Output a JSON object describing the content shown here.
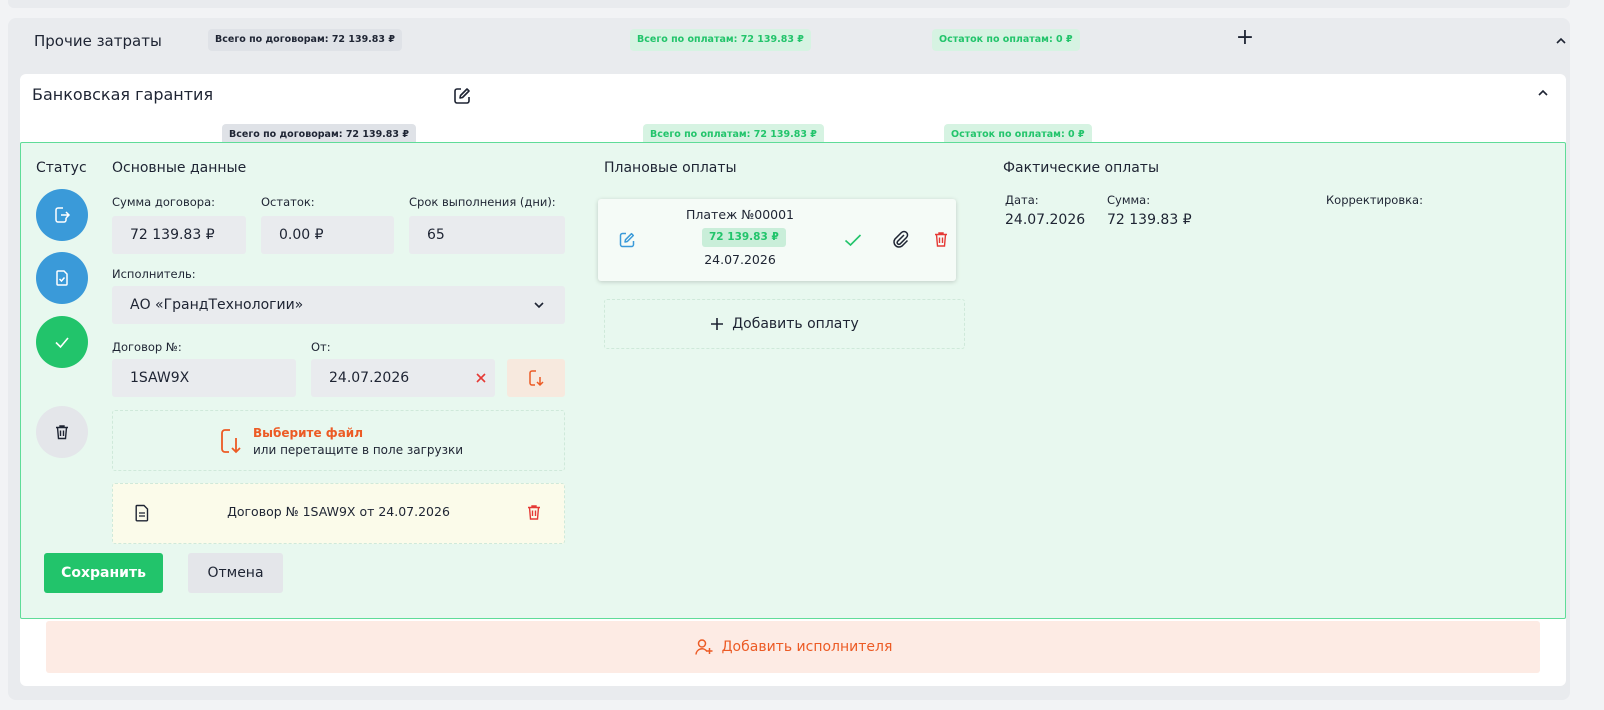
{
  "outer": {
    "title": "Прочие затраты",
    "tag_contracts": "Всего по договорам: 72 139.83 ₽",
    "tag_payments": "Всего по оплатам: 72 139.83 ₽",
    "tag_remaining": "Остаток по оплатам: 0 ₽"
  },
  "inner": {
    "title": "Банковская гарантия",
    "tag_contracts": "Всего по договорам: 72 139.83 ₽",
    "tag_payments": "Всего по оплатам: 72 139.83 ₽",
    "tag_remaining": "Остаток по оплатам: 0 ₽"
  },
  "status": {
    "heading": "Статус"
  },
  "main": {
    "heading": "Основные данные",
    "sum_label": "Сумма договора:",
    "sum_value": "72 139.83 ₽",
    "remain_label": "Остаток:",
    "remain_value": "0.00 ₽",
    "term_label": "Срок выполнения (дни):",
    "term_value": "65",
    "executor_label": "Исполнитель:",
    "executor_value": "АО «ГрандТехнологии»",
    "contract_label": "Договор №:",
    "contract_value": "1SAW9X",
    "from_label": "От:",
    "from_value": "24.07.2026",
    "upload_choose": "Выберите файл",
    "upload_drag": "или перетащите в поле загрузки",
    "file_name": "Договор № 1SAW9X от 24.07.2026"
  },
  "planned": {
    "heading": "Плановые оплаты",
    "payment_title": "Платеж №00001",
    "payment_amount": "72 139.83 ₽",
    "payment_date": "24.07.2026",
    "add_label": "Добавить оплату"
  },
  "actual": {
    "heading": "Фактические оплаты",
    "date_label": "Дата:",
    "date_value": "24.07.2026",
    "sum_label": "Сумма:",
    "sum_value": "72 139.83 ₽",
    "correction_label": "Корректировка:"
  },
  "actions": {
    "save": "Сохранить",
    "cancel": "Отмена",
    "add_executor": "Добавить исполнителя"
  },
  "colors": {
    "green": "#22c46b",
    "blue": "#3a9ad9",
    "orange": "#ec5b25",
    "red": "#e53935"
  }
}
